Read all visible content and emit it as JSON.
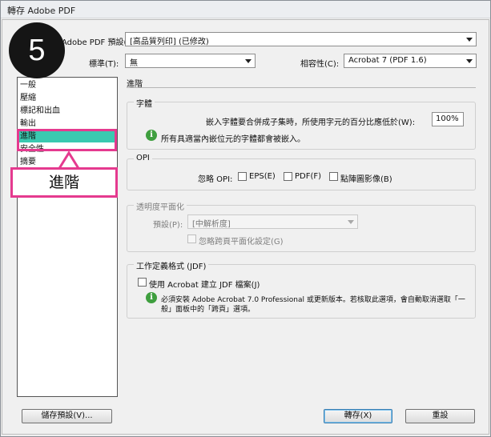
{
  "window": {
    "title": "轉存 Adobe PDF"
  },
  "top": {
    "preset_label": "Adobe PDF 預設(S):",
    "preset_value": "[高品質列印] (已修改)",
    "standard_label": "標準(T):",
    "standard_value": "無",
    "compat_label": "相容性(C):",
    "compat_value": "Acrobat 7 (PDF 1.6)"
  },
  "sidebar": {
    "items": [
      {
        "label": "一般"
      },
      {
        "label": "壓縮"
      },
      {
        "label": "標記和出血"
      },
      {
        "label": "輸出"
      },
      {
        "label": "進階"
      },
      {
        "label": "安全性"
      },
      {
        "label": "摘要"
      }
    ],
    "selected_index": 4
  },
  "main": {
    "heading": "進階",
    "fonts": {
      "title": "字體",
      "subset_label": "嵌入字體要合併成子集時，所使用字元的百分比應低於(W):",
      "subset_value": "100%",
      "note": "所有具適當內嵌位元的字體都會被嵌入。"
    },
    "opi": {
      "title": "OPI",
      "omit_label": "忽略 OPI:",
      "eps": "EPS(E)",
      "pdf": "PDF(F)",
      "bitmap": "點陣圖影像(B)"
    },
    "flatten": {
      "title": "透明度平面化",
      "preset_label": "預設(P):",
      "preset_value": "[中解析度]",
      "ignore_label": "忽略跨頁平面化設定(G)"
    },
    "jdf": {
      "title": "工作定義格式 (JDF)",
      "create_label": "使用 Acrobat 建立 JDF 檔案(J)",
      "note_line1": "必須安裝 Adobe Acrobat 7.0 Professional 或更新版本。若核取此選項，會自動取消選取「一",
      "note_line2": "般」面板中的「跨頁」選項。"
    }
  },
  "buttons": {
    "save_preset": "儲存預設(V)...",
    "export": "轉存(X)",
    "reset": "重設"
  },
  "overlay": {
    "step_number": "5",
    "callout_text": "進階",
    "accent_color": "#e53a8f",
    "selection_color": "#3ac9b0"
  }
}
